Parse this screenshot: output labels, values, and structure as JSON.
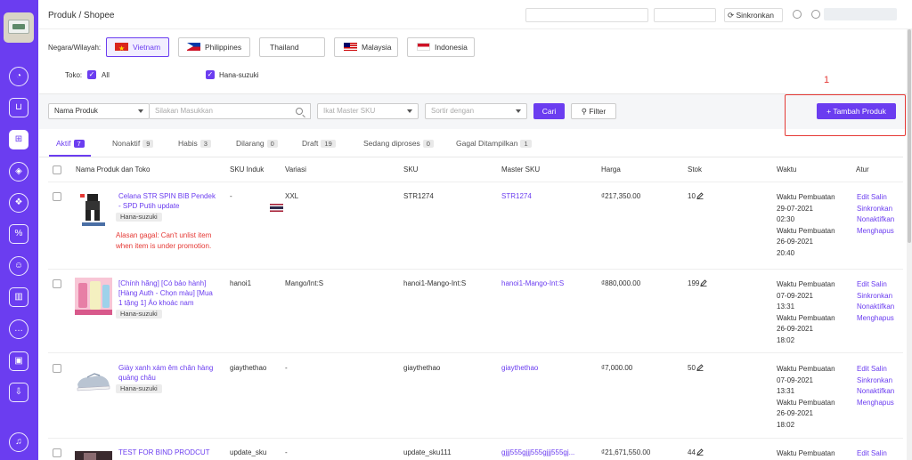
{
  "breadcrumb": "Produk / Shopee",
  "topbar": {
    "sync_label": "Sinkronkan"
  },
  "region": {
    "label": "Negara/Wilayah:",
    "countries": [
      {
        "name": "Vietnam",
        "flag": "vn",
        "selected": true
      },
      {
        "name": "Philippines",
        "flag": "ph"
      },
      {
        "name": "Thailand",
        "flag": "th"
      },
      {
        "name": "Malaysia",
        "flag": "my"
      },
      {
        "name": "Indonesia",
        "flag": "id"
      }
    ]
  },
  "shops": {
    "label": "Toko:",
    "items": [
      "All",
      "Hana-suzuki"
    ]
  },
  "filter": {
    "field_select": "Nama Produk",
    "search_placeholder": "Silakan Masukkan",
    "master_sku_placeholder": "Ikat Master SKU",
    "sort_placeholder": "Sortir dengan",
    "search_button": "Cari",
    "filter_button": "Filter",
    "add_button": "Tambah Produk"
  },
  "annotation": "1",
  "tabs": [
    {
      "label": "Aktif",
      "count": "7"
    },
    {
      "label": "Nonaktif",
      "count": "9"
    },
    {
      "label": "Habis",
      "count": "3"
    },
    {
      "label": "Dilarang",
      "count": "0"
    },
    {
      "label": "Draft",
      "count": "19"
    },
    {
      "label": "Sedang diproses",
      "count": "0"
    },
    {
      "label": "Gagal Ditampilkan",
      "count": "1"
    }
  ],
  "columns": [
    "Nama Produk dan Toko",
    "SKU Induk",
    "Variasi",
    "SKU",
    "Master SKU",
    "Harga",
    "Stok",
    "Waktu",
    "Atur"
  ],
  "time_labels": {
    "created": "Waktu Pembuatan"
  },
  "actions": [
    "Edit Salin",
    "Sinkronkan",
    "Nonaktifkan",
    "Menghapus"
  ],
  "rows": [
    {
      "name": "Celana STR SPIN BIB Pendek - SPD Putih update",
      "shop": "Hana-suzuki",
      "error": "Alasan gagal: Can't unlist item when item is under promotion.",
      "parent_sku": "-",
      "variation": "XXL",
      "sku": "STR1274",
      "master_sku": "STR1274",
      "price": "₫217,350.00",
      "stock": "10",
      "time1_date": "29-07-2021",
      "time1_clock": "02:30",
      "time2_date": "26-09-2021",
      "time2_clock": "20:40"
    },
    {
      "name": "[Chính hãng] [Có bảo hành] [Hàng Auth - Chọn màu] [Mua 1 tặng 1] Áo khoác nam",
      "shop": "Hana-suzuki",
      "parent_sku": "hanoi1",
      "variation": "Mango/Int:S",
      "sku": "hanoi1-Mango-Int:S",
      "master_sku": "hanoi1-Mango-Int:S",
      "price": "₫880,000.00",
      "stock": "199",
      "time1_date": "07-09-2021",
      "time1_clock": "13:31",
      "time2_date": "26-09-2021",
      "time2_clock": "18:02"
    },
    {
      "name": "Giày xanh xám êm chân hàng quảng châu",
      "shop": "Hana-suzuki",
      "parent_sku": "giaythethao",
      "variation": "-",
      "sku": "giaythethao",
      "master_sku": "giaythethao",
      "price": "₫7,000.00",
      "stock": "50",
      "time1_date": "07-09-2021",
      "time1_clock": "13:31",
      "time2_date": "26-09-2021",
      "time2_clock": "18:02"
    },
    {
      "name": "TEST FOR BIND PRODCUT",
      "parent_sku": "update_sku",
      "variation": "-",
      "sku": "update_sku111",
      "master_sku": "gjjj555gjjj555gjjj555gj...",
      "price": "₫21,671,550.00",
      "stock": "44",
      "action_first": "Edit Salin"
    }
  ]
}
